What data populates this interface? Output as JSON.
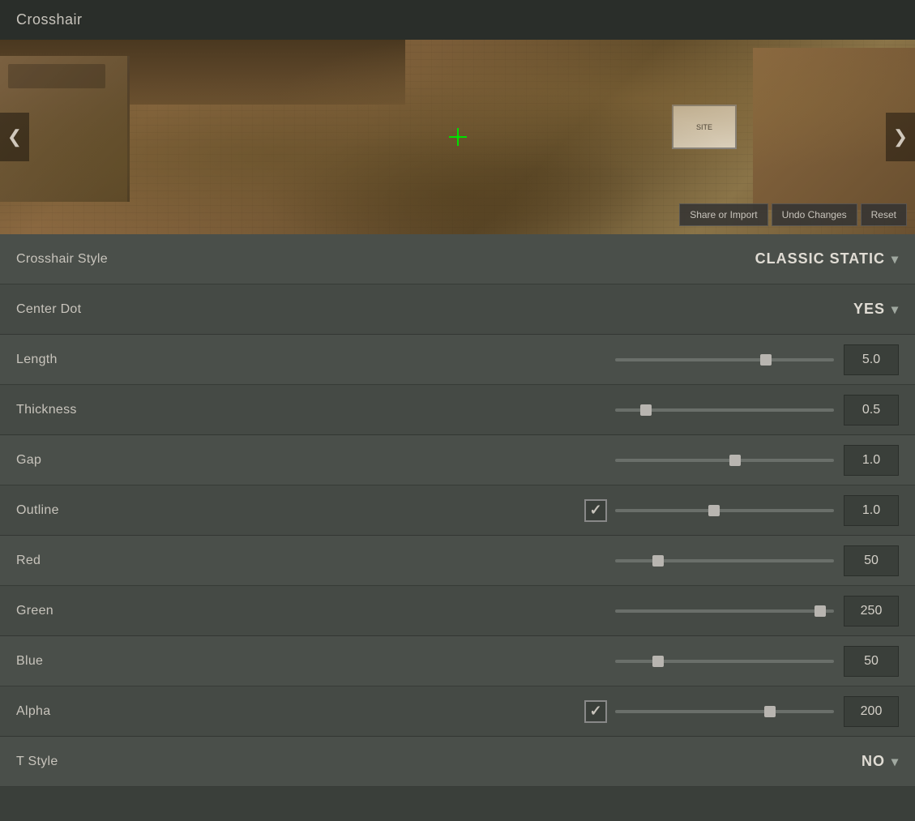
{
  "title": "Crosshair",
  "preview": {
    "left_arrow": "❮",
    "right_arrow": "❯",
    "buttons": {
      "share": "Share or Import",
      "undo": "Undo Changes",
      "reset": "Reset"
    }
  },
  "settings": {
    "crosshair_style": {
      "label": "Crosshair Style",
      "value": "CLASSIC STATIC",
      "dropdown_arrow": "▾"
    },
    "center_dot": {
      "label": "Center Dot",
      "value": "YES",
      "dropdown_arrow": "▾"
    },
    "length": {
      "label": "Length",
      "slider_percent": 70,
      "thumb_percent": 70,
      "value": "5.0"
    },
    "thickness": {
      "label": "Thickness",
      "slider_percent": 12,
      "thumb_percent": 12,
      "value": "0.5"
    },
    "gap": {
      "label": "Gap",
      "slider_percent": 55,
      "thumb_percent": 55,
      "value": "1.0"
    },
    "outline": {
      "label": "Outline",
      "checked": true,
      "slider_percent": 45,
      "thumb_percent": 45,
      "value": "1.0"
    },
    "red": {
      "label": "Red",
      "slider_percent": 18,
      "thumb_percent": 18,
      "value": "50"
    },
    "green": {
      "label": "Green",
      "slider_percent": 96,
      "thumb_percent": 96,
      "value": "250"
    },
    "blue": {
      "label": "Blue",
      "slider_percent": 18,
      "thumb_percent": 18,
      "value": "50"
    },
    "alpha": {
      "label": "Alpha",
      "checked": true,
      "slider_percent": 72,
      "thumb_percent": 72,
      "value": "200"
    },
    "t_style": {
      "label": "T Style",
      "value": "NO",
      "dropdown_arrow": "▾"
    }
  }
}
